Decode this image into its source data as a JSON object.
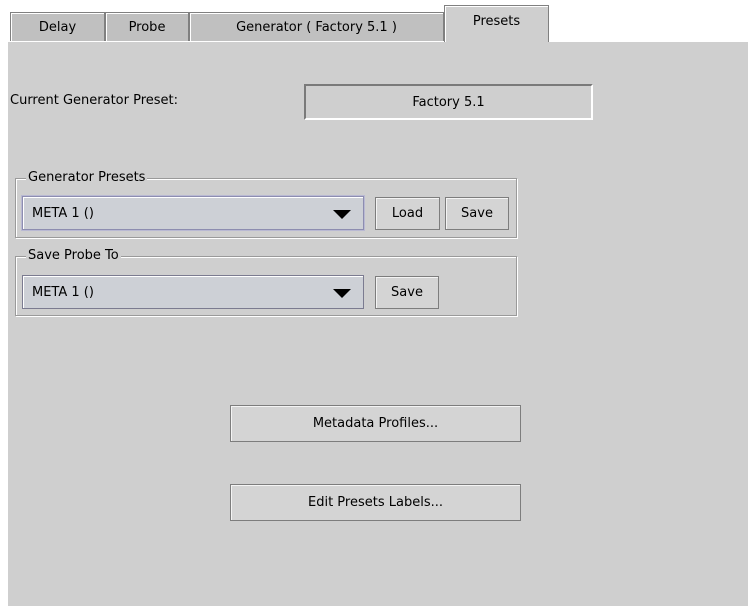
{
  "tabs": [
    {
      "label": "Delay"
    },
    {
      "label": "Probe"
    },
    {
      "label": "Generator ( Factory 5.1 )"
    },
    {
      "label": "Presets"
    }
  ],
  "current_preset": {
    "label": "Current Generator Preset:",
    "value": "Factory 5.1"
  },
  "generator_presets": {
    "legend": "Generator Presets",
    "selected": "META 1 ()",
    "load_label": "Load",
    "save_label": "Save"
  },
  "save_probe": {
    "legend": "Save Probe To",
    "selected": "META 1 ()",
    "save_label": "Save"
  },
  "buttons": {
    "metadata_profiles": "Metadata Profiles...",
    "edit_presets_labels": "Edit Presets Labels..."
  }
}
